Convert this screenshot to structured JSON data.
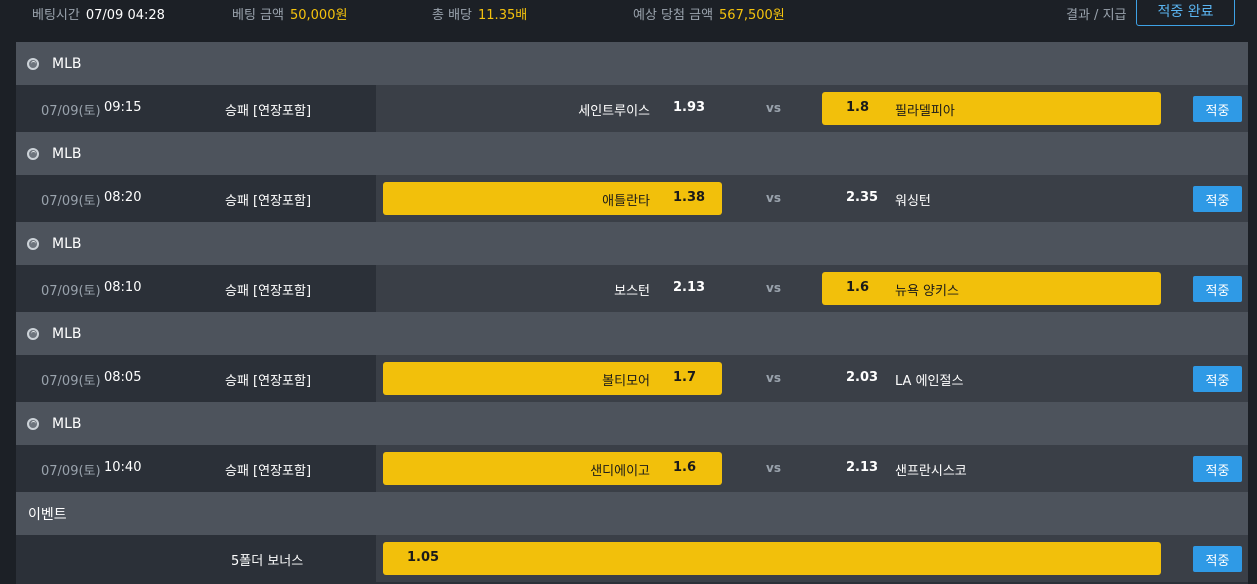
{
  "top": {
    "bet_time_label": "베팅시간",
    "bet_time": "07/09 04:28",
    "bet_amount_label": "베팅 금액",
    "bet_amount": "50,000원",
    "total_odds_label": "총 배당",
    "total_odds": "11.35배",
    "expected_label": "예상 당첨 금액",
    "expected": "567,500원",
    "result_label": "결과 / 지급",
    "result_button": "적중 완료"
  },
  "games": [
    {
      "league": "MLB",
      "date": "07/09(토)",
      "time": "09:15",
      "market": "승패 [연장포함]",
      "home": "세인트루이스",
      "home_odds": "1.93",
      "vs": "vs",
      "away_odds": "1.8",
      "away": "필라델피아",
      "selected": "away",
      "result": "적중"
    },
    {
      "league": "MLB",
      "date": "07/09(토)",
      "time": "08:20",
      "market": "승패 [연장포함]",
      "home": "애틀란타",
      "home_odds": "1.38",
      "vs": "vs",
      "away_odds": "2.35",
      "away": "워싱턴",
      "selected": "home",
      "result": "적중"
    },
    {
      "league": "MLB",
      "date": "07/09(토)",
      "time": "08:10",
      "market": "승패 [연장포함]",
      "home": "보스턴",
      "home_odds": "2.13",
      "vs": "vs",
      "away_odds": "1.6",
      "away": "뉴욕 양키스",
      "selected": "away",
      "result": "적중"
    },
    {
      "league": "MLB",
      "date": "07/09(토)",
      "time": "08:05",
      "market": "승패 [연장포함]",
      "home": "볼티모어",
      "home_odds": "1.7",
      "vs": "vs",
      "away_odds": "2.03",
      "away": "LA 에인절스",
      "selected": "home",
      "result": "적중"
    },
    {
      "league": "MLB",
      "date": "07/09(토)",
      "time": "10:40",
      "market": "승패 [연장포함]",
      "home": "샌디에이고",
      "home_odds": "1.6",
      "vs": "vs",
      "away_odds": "2.13",
      "away": "샌프란시스코",
      "selected": "home",
      "result": "적중"
    }
  ],
  "event": {
    "header": "이벤트",
    "name": "5폴더 보너스",
    "odds": "1.05",
    "result": "적중"
  },
  "colors": {
    "selected_bg": "#f2c00b",
    "hit_button": "#2f9ae6",
    "header_bg": "#4d535c",
    "accent_yellow": "#f4c20d"
  }
}
